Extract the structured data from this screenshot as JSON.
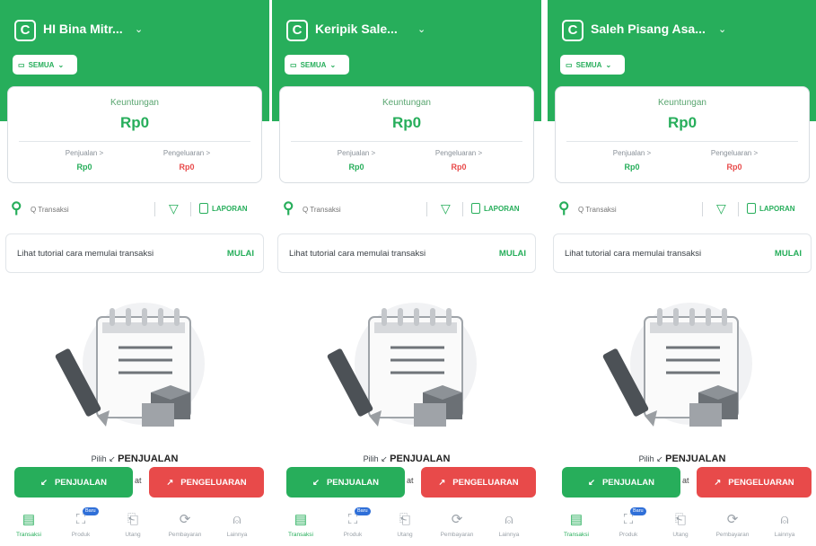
{
  "screens": [
    {
      "store_name": "HI Bina Mitr...",
      "hdr_width": 300
    },
    {
      "store_name": "Keripik Sale...",
      "hdr_width": 300
    },
    {
      "store_name": "Saleh Pisang Asa...",
      "hdr_width": 300
    }
  ],
  "common": {
    "logo_letter": "C",
    "chevron": "⌄",
    "date_filter_label": "SEMUA",
    "profit_label": "Keuntungan",
    "profit_value": "Rp0",
    "sales_label": "Penjualan >",
    "sales_value": "Rp0",
    "expense_label": "Pengeluaran >",
    "expense_value": "Rp0",
    "search_placeholder": "Q Transaksi",
    "report_label": "LAPORAN",
    "tutorial_text": "Lihat tutorial cara memulai transaksi",
    "tutorial_action": "MULAI",
    "pilih_prefix": "Pilih ↙",
    "pilih_bold": "PENJUALAN",
    "pilih_behind": "at",
    "sales_button": "PENJUALAN",
    "expense_button": "PENGELUARAN",
    "nav": [
      {
        "label": "Transaksi",
        "icon": "receipt-icon",
        "glyph": "▤",
        "active": true
      },
      {
        "label": "Produk",
        "icon": "box-icon",
        "glyph": "⛶",
        "badge": "Baru"
      },
      {
        "label": "Utang",
        "icon": "book-icon",
        "glyph": "⎗"
      },
      {
        "label": "Pembayaran",
        "icon": "sync-icon",
        "glyph": "⟳"
      },
      {
        "label": "Lainnya",
        "icon": "user-icon",
        "glyph": "⍝"
      }
    ]
  },
  "colors": {
    "brand_green": "#27ae5b",
    "expense_red": "#e84a4a",
    "badge_blue": "#2f6fd8"
  }
}
